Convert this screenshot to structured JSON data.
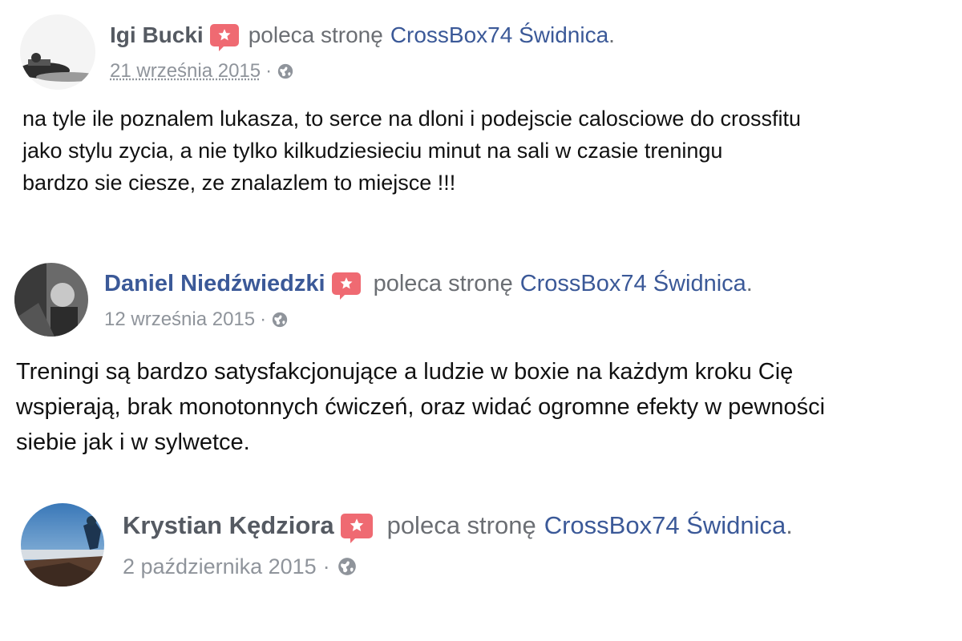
{
  "reviews": [
    {
      "author": "Igi Bucki",
      "action": "poleca stronę",
      "page": "CrossBox74 Świdnica",
      "page_end": ".",
      "date": "21 września 2015",
      "separator": "·",
      "privacy_icon": "globe-icon",
      "badge_icon": "star-recommendation-icon",
      "text_lines": [
        "na tyle ile poznalem lukasza, to serce na dloni i podejscie calosciowe do crossfitu",
        "jako stylu zycia, a nie tylko kilkudziesieciu minut na sali w czasie treningu",
        "bardzo sie ciesze, ze znalazlem to miejsce !!!"
      ]
    },
    {
      "author": "Daniel Niedźwiedzki",
      "action": "poleca stronę",
      "page": "CrossBox74 Świdnica",
      "page_end": ".",
      "date": "12 września 2015",
      "separator": "·",
      "privacy_icon": "globe-icon",
      "badge_icon": "star-recommendation-icon",
      "text_lines": [
        "Treningi są bardzo satysfakcjonujące a ludzie w boxie na każdym kroku Cię",
        "wspierają, brak monotonnych ćwiczeń, oraz widać ogromne efekty w pewności",
        "siebie jak i w sylwetce."
      ]
    },
    {
      "author": "Krystian Kędziora",
      "action": "poleca stronę",
      "page": "CrossBox74 Świdnica",
      "page_end": ".",
      "date": "2 października 2015",
      "separator": "·",
      "privacy_icon": "globe-icon",
      "badge_icon": "star-recommendation-icon",
      "text_lines": []
    }
  ],
  "colors": {
    "author_gray": "#555a62",
    "author_blue": "#3b5998",
    "link_blue": "#3b5998",
    "meta_gray": "#8f949b",
    "badge_red": "#ef6a72"
  }
}
